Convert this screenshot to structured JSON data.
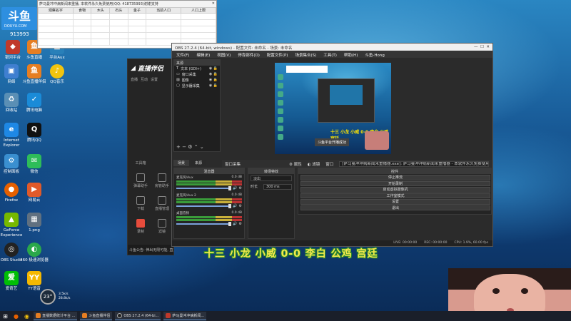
{
  "desktop": {
    "logo": {
      "text": "斗鱼",
      "sub": "DOUYU.COM"
    },
    "id_partial": "913993",
    "icons": [
      {
        "label": "银河平台",
        "icon": "app-icon",
        "color": "#c0392b"
      },
      {
        "label": "斗鱼直播",
        "icon": "app-icon",
        "color": "#e67e22"
      },
      {
        "label": "平台Aux",
        "icon": "app-icon",
        "color": "#2980b9"
      },
      {
        "label": "网络",
        "icon": "network-icon",
        "color": "#3f7fd0"
      },
      {
        "label": "斗鱼直播伴侣",
        "icon": "app-icon",
        "color": "#e67e22"
      },
      {
        "label": "QQ音乐",
        "icon": "music-icon",
        "color": "#f1c40f"
      },
      {
        "label": "回收站",
        "icon": "recycle-bin-icon",
        "color": "#5a8fb5"
      },
      {
        "label": "腾讯电脑",
        "icon": "app-icon",
        "color": "#1a8bd8"
      },
      {
        "label": "Internet Explorer",
        "icon": "ie-icon",
        "color": "#1e88e5"
      },
      {
        "label": "腾讯QQ",
        "icon": "qq-icon",
        "color": "#111111"
      },
      {
        "label": "控制面板",
        "icon": "control-panel-icon",
        "color": "#3a8fd0"
      },
      {
        "label": "微信",
        "icon": "wechat-icon",
        "color": "#2ebd59"
      },
      {
        "label": "Firefox",
        "icon": "firefox-icon",
        "color": "#e66000"
      },
      {
        "label": "网易云",
        "icon": "app-icon",
        "color": "#e05a2a"
      },
      {
        "label": "GeForce Experience",
        "icon": "nvidia-icon",
        "color": "#76b900"
      },
      {
        "label": "1.png",
        "icon": "image-file-icon",
        "color": "#607080"
      },
      {
        "label": "OBS Studio",
        "icon": "obs-icon",
        "color": "#222222"
      },
      {
        "label": "360 极速浏览器",
        "icon": "browser-icon",
        "color": "#2aa84a"
      },
      {
        "label": "爱奇艺",
        "icon": "iqiyi-icon",
        "color": "#00be06"
      },
      {
        "label": "YY语音",
        "icon": "yy-icon",
        "color": "#f5b800"
      }
    ]
  },
  "spreadsheet": {
    "title": "萨马曼冲冲病新闻来重播, 本软件永久免费使用(QQ: 418735993)谢谢支持",
    "columns": [
      "观察名字",
      "食物",
      "木头",
      "石头",
      "金子",
      "当前人口",
      "人口上限"
    ]
  },
  "companion": {
    "app_name": "直播伴侣",
    "nav": [
      "直播",
      "互动",
      "设置"
    ],
    "tools": [
      {
        "label": "工具箱",
        "icon": "toolbox-icon"
      },
      {
        "label": "弹幕助手",
        "icon": "danmu-icon"
      },
      {
        "label": "房管助手",
        "icon": "admin-icon"
      },
      {
        "label": "下载",
        "icon": "download-icon"
      },
      {
        "label": "直播管理",
        "icon": "manage-icon"
      },
      {
        "label": "录制",
        "icon": "record-icon"
      },
      {
        "label": "滤镜",
        "icon": "filter-icon"
      }
    ],
    "notice": "斗鱼公告: 伸出无限可能, 直播精彩不..."
  },
  "obs": {
    "title": "OBS 27.2.4 (64-bit, windows) - 配置文件: 未命名 - 场景: 未命名",
    "menu": [
      "文件(F)",
      "编辑(E)",
      "视图(V)",
      "停靠部件(D)",
      "配置文件(P)",
      "场景集合(S)",
      "工具(T)",
      "帮助(H)",
      "斗鱼-Hong"
    ],
    "sources_header": "来源",
    "sources": [
      {
        "name": "文本 (GDI+)",
        "icon": "text-icon"
      },
      {
        "name": "窗口采集",
        "icon": "window-icon"
      },
      {
        "name": "图像",
        "icon": "image-icon"
      },
      {
        "name": "显示器采集",
        "icon": "monitor-icon"
      }
    ],
    "preview": {
      "overlay_text": "十三 小龙 小威 0-0 李白 公鸡 宫廷",
      "toast": "斗鱼平台开播成功"
    },
    "toolbar": {
      "scene_label": "窗口采集",
      "properties": "属性",
      "filters": "滤镜",
      "window_label": "窗口",
      "window_value": "[萨马曼冲冲病新闻来重播器.exe]: 萨马曼冲冲病新闻来重播器 - 本软件永久免费使用(QQ: 418..."
    },
    "tabs": [
      "场景",
      "来源"
    ],
    "mixer": {
      "header": "混音器",
      "channels": [
        {
          "name": "麦克风/Aux",
          "db": "0.0 dB"
        },
        {
          "name": "麦克风/Aux 2",
          "db": "0.0 dB"
        },
        {
          "name": "桌面音频",
          "db": "0.0 dB"
        }
      ]
    },
    "transitions": {
      "header": "转场特效",
      "type_value": "淡出",
      "duration_label": "时长",
      "duration_value": "300 ms"
    },
    "controls": {
      "header": "控件",
      "buttons": [
        "停止推流",
        "开始录制",
        "启动虚拟摄像机",
        "工作室模式",
        "设置",
        "退出"
      ]
    },
    "status": {
      "live": "LIVE: 00:00:00",
      "rec": "REC: 00:00:00",
      "cpu": "CPU: 1.9%, 60.00 fps"
    }
  },
  "overlay": {
    "caption": "十三 小龙 小威 0-0 李白 公鸡 宫廷"
  },
  "clock_widget": {
    "temp": "23",
    "unit": "°",
    "line1": "3.5k/s",
    "line2": "28.8k/s"
  },
  "taskbar": {
    "apps": [
      {
        "label": "直播数据统计平台 ...",
        "color": "#e67e22"
      },
      {
        "label": "斗鱼直播伴侣",
        "color": "#e67e22"
      },
      {
        "label": "OBS 27.2.4 (64-bi...",
        "color": "#222222"
      },
      {
        "label": "萨马曼冲冲病新闻...",
        "color": "#c0392b"
      }
    ]
  }
}
